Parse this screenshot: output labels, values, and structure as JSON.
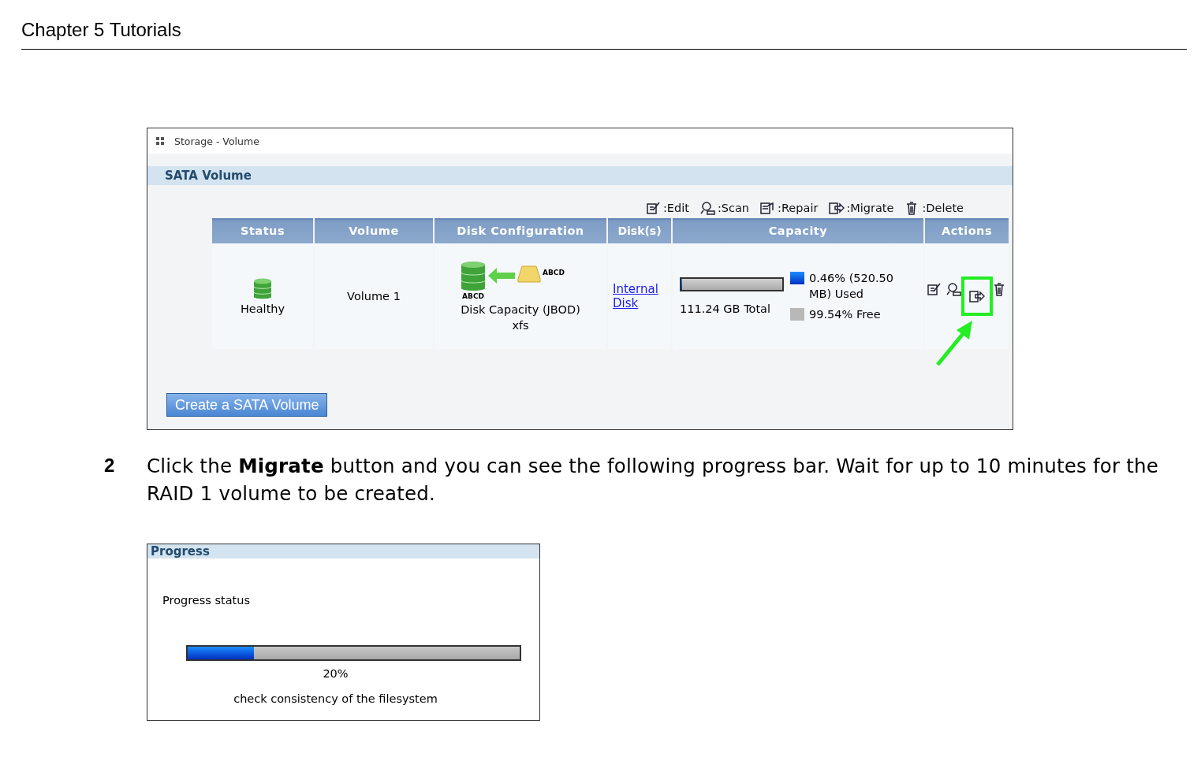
{
  "header": {
    "title": "Chapter 5 Tutorials"
  },
  "volume_screen": {
    "breadcrumb": "Storage - Volume",
    "section_title": "SATA Volume",
    "legend": [
      {
        "kind": "edit",
        "label": ":Edit"
      },
      {
        "kind": "scan",
        "label": ":Scan"
      },
      {
        "kind": "repair",
        "label": ":Repair"
      },
      {
        "kind": "migrate",
        "label": ":Migrate"
      },
      {
        "kind": "delete",
        "label": ":Delete"
      }
    ],
    "table": {
      "columns": [
        "Status",
        "Volume",
        "Disk Configuration",
        "Disk(s)",
        "Capacity",
        "Actions"
      ],
      "rows": [
        {
          "status": "Healthy",
          "volume": "Volume 1",
          "disk_config": {
            "target_label": "ABCD",
            "source_label": "ABCD",
            "description": "Disk Capacity (JBOD)",
            "filesystem": "xfs"
          },
          "disks": "Internal Disk",
          "capacity": {
            "level": 0.0046,
            "total": "111.24 GB Total",
            "used": "0.46% (520.50 MB) Used",
            "free": "99.54% Free"
          },
          "actions": [
            {
              "kind": "edit",
              "highlighted": false
            },
            {
              "kind": "scan",
              "highlighted": false
            },
            {
              "kind": "migrate",
              "highlighted": true
            },
            {
              "kind": "delete",
              "highlighted": false
            }
          ]
        }
      ]
    },
    "create_button": "Create a SATA Volume"
  },
  "step": {
    "number": "2",
    "text": "Click the **Migrate** button and you can see the following progress bar. Wait for up to 10 minutes for the RAID 1 volume to be created."
  },
  "progress_screen": {
    "title": "Progress",
    "label": "Progress status",
    "level": 0.2,
    "reading": "20%",
    "message": "check consistency of the filesystem"
  }
}
